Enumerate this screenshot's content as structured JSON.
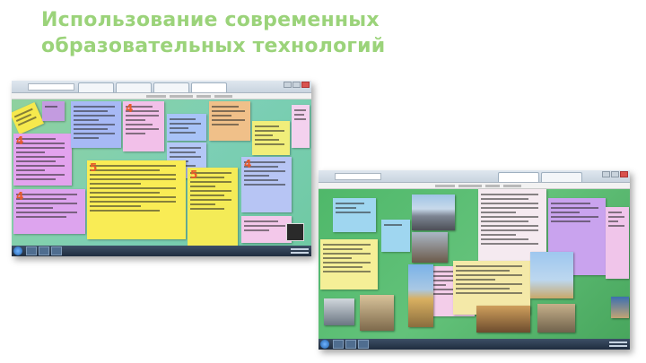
{
  "slide": {
    "title_line1": "Использование современных",
    "title_line2": "образовательных технологий"
  },
  "left_screenshot": {
    "note_numbers": [
      "4",
      "4",
      "5",
      "4",
      "5",
      "4"
    ]
  },
  "right_screenshot": {
    "labels": {}
  },
  "colors": {
    "title": "#9bd37a",
    "left_background": "#7ccfb5",
    "right_background": "#4fb86a",
    "note_number": "#e85a2a"
  }
}
